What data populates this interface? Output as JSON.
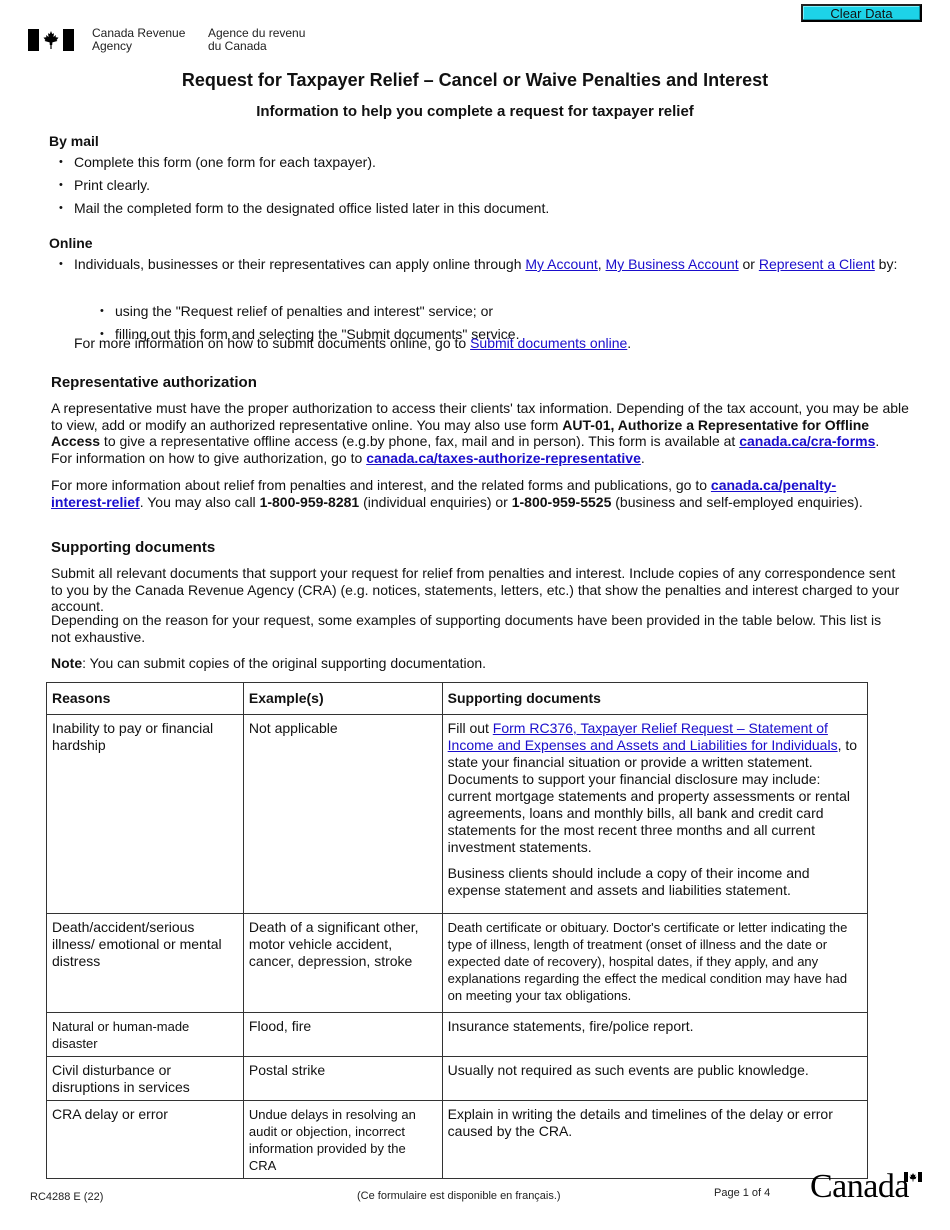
{
  "toolbar": {
    "clear_label": "Clear Data"
  },
  "header": {
    "logo_icon": "canada-flag-icon",
    "dept_en_line1": "Canada Revenue",
    "dept_en_line2": "Agency",
    "dept_fr_line1": "Agence du revenu",
    "dept_fr_line2": "du Canada"
  },
  "title": "Request for Taxpayer Relief – Cancel or Waive Penalties and Interest",
  "subtitle": "Information to help you complete a request for taxpayer relief",
  "by_mail": {
    "heading": "By mail",
    "items": [
      "Complete this form (one form for each taxpayer).",
      "Print clearly.",
      "Mail the completed form to the designated office listed later in this document."
    ]
  },
  "online": {
    "heading": "Online",
    "intro_text": "Individuals, businesses or their representatives can apply online through ",
    "link_my_account": "My Account",
    "sep1": ", ",
    "link_my_business_account": "My Business Account",
    "sep2": " or ",
    "link_represent_client": "Represent a Client",
    "intro_end": " by:",
    "sub_items": [
      "using the \"Request relief of penalties and interest\" service; or",
      "filling out this form and selecting the \"Submit documents\" service."
    ],
    "more_info_text": "For more information on how to submit documents online, go to ",
    "more_info_link": "Submit documents online",
    "more_info_end": "."
  },
  "rep_auth": {
    "heading": "Representative authorization",
    "p1_a": "A representative must have the proper authorization to access their clients' tax information. Depending of the tax account, you may be able to view, add or modify an authorized representative online. You may also use form ",
    "p1_bold": "AUT-01, Authorize a Representative for Offline Access",
    "p1_b": " to give a representative offline access (e.g.by phone, fax, mail and in person). This form is available at ",
    "p1_link": "canada.ca/cra-forms",
    "p1_c": ".",
    "p1_d": "For information on how to give authorization, go to ",
    "p1_link2": "canada.ca/taxes-authorize-representative",
    "p1_e": ".",
    "p2_a": "For more information about relief from penalties and interest, and the related forms and publications, go to ",
    "p2_link": "canada.ca/penalty-interest-relief",
    "p2_b": ". You may also call ",
    "p2_phone1": "1-800-959-8281",
    "p2_c": " (individual enquiries) or ",
    "p2_phone2": "1-800-959-5525",
    "p2_d": " (business and self-employed enquiries)."
  },
  "supporting": {
    "heading": "Supporting documents",
    "p1": "Submit all relevant documents that support your request for relief from penalties and interest. Include copies of any correspondence sent to you by the Canada Revenue Agency (CRA) (e.g. notices, statements, letters, etc.) that show the penalties and interest charged to your account.",
    "p2": "Depending on the reason for your request, some examples of supporting documents have been provided in the table below. This list is not exhaustive.",
    "note_label": "Note",
    "note_text": ": You can submit copies of the original supporting documentation."
  },
  "table": {
    "headers": [
      "Reasons",
      "Example(s)",
      "Supporting documents"
    ],
    "rows": [
      {
        "reason": "Inability to pay or financial hardship",
        "examples": "Not applicable",
        "docs_prefix": "Fill out ",
        "docs_link": "Form RC376, Taxpayer Relief Request – Statement of Income and Expenses and Assets and Liabilities for Individuals",
        "docs_text": ", to state your financial situation or provide a written statement. Documents to support your financial disclosure may include: current mortgage statements and property assessments or rental agreements, loans and monthly bills, all bank and credit card statements for the most recent three months and all current investment statements.",
        "docs_p2": "Business clients should include a copy of their income and expense statement and assets and liabilities statement."
      },
      {
        "reason": "Death/accident/serious illness/ emotional or mental distress",
        "examples": "Death of a significant other, motor vehicle accident, cancer, depression, stroke",
        "docs_text": "Death certificate or obituary. Doctor's certificate or letter indicating the type of illness, length of treatment (onset of illness and the date or expected date of recovery), hospital dates, if they apply, and any explanations regarding the effect the medical condition may have had on meeting your tax obligations."
      },
      {
        "reason": "Natural or human-made disaster",
        "examples": "Flood, fire",
        "docs_text": "Insurance statements, fire/police report."
      },
      {
        "reason": "Civil disturbance or disruptions in services",
        "examples": "Postal strike",
        "docs_text": "Usually not required as such events are public knowledge."
      },
      {
        "reason": "CRA delay or error",
        "examples": "Undue delays in resolving an audit or objection, incorrect information provided by the CRA",
        "docs_text": "Explain in writing the details and timelines of the delay or error caused by the CRA."
      }
    ]
  },
  "footer": {
    "form_code": "RC4288 E (22)",
    "french_note": "(Ce formulaire est disponible en français.)",
    "page_label": "Page 1 of 4",
    "wordmark": "Canada",
    "wordmark_icon": "canada-wordmark-flag-icon"
  }
}
